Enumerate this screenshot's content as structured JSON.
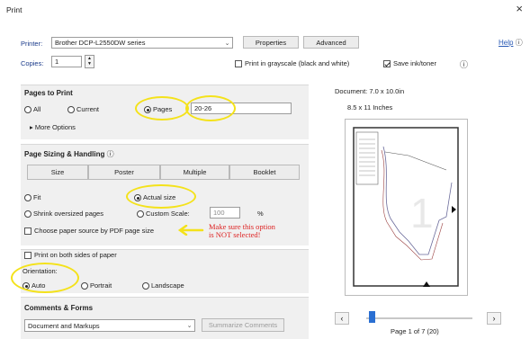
{
  "window": {
    "title": "Print",
    "close": "×"
  },
  "top": {
    "printer_label": "Printer:",
    "printer_value": "Brother DCP-L2550DW series",
    "properties": "Properties",
    "advanced": "Advanced",
    "help": "Help",
    "help_icon": "ⓘ",
    "copies_label": "Copies:",
    "copies_value": "1",
    "grayscale": "Print in grayscale (black and white)",
    "save_ink": "Save ink/toner",
    "info_icon": "ⓘ"
  },
  "pages": {
    "title": "Pages to Print",
    "all": "All",
    "current": "Current",
    "pages": "Pages",
    "range": "20-26",
    "more": "▸ More Options"
  },
  "sizing": {
    "title": "Page Sizing & Handling",
    "info_icon": "ⓘ",
    "size": "Size",
    "poster": "Poster",
    "multiple": "Multiple",
    "booklet": "Booklet",
    "fit": "Fit",
    "actual": "Actual size",
    "shrink": "Shrink oversized pages",
    "custom": "Custom Scale:",
    "scale": "100",
    "pct": "%",
    "choose_source": "Choose paper source by PDF page size",
    "note_line1": "Make sure this option",
    "note_line2": "is NOT selected!",
    "both_sides": "Print on both sides of paper",
    "orientation": "Orientation:",
    "auto": "Auto",
    "portrait": "Portrait",
    "landscape": "Landscape"
  },
  "comments": {
    "title": "Comments & Forms",
    "value": "Document and Markups",
    "summarize": "Summarize Comments"
  },
  "preview": {
    "doc": "Document: 7.0 x 10.0in",
    "paper": "8.5 x 11 Inches",
    "page_info": "Page 1 of 7 (20)",
    "prev": "‹",
    "next": "›",
    "slider_pos": 0.05
  },
  "colors": {
    "highlight": "#f4e21a",
    "note": "#d22222",
    "link": "#2a5ab5"
  }
}
